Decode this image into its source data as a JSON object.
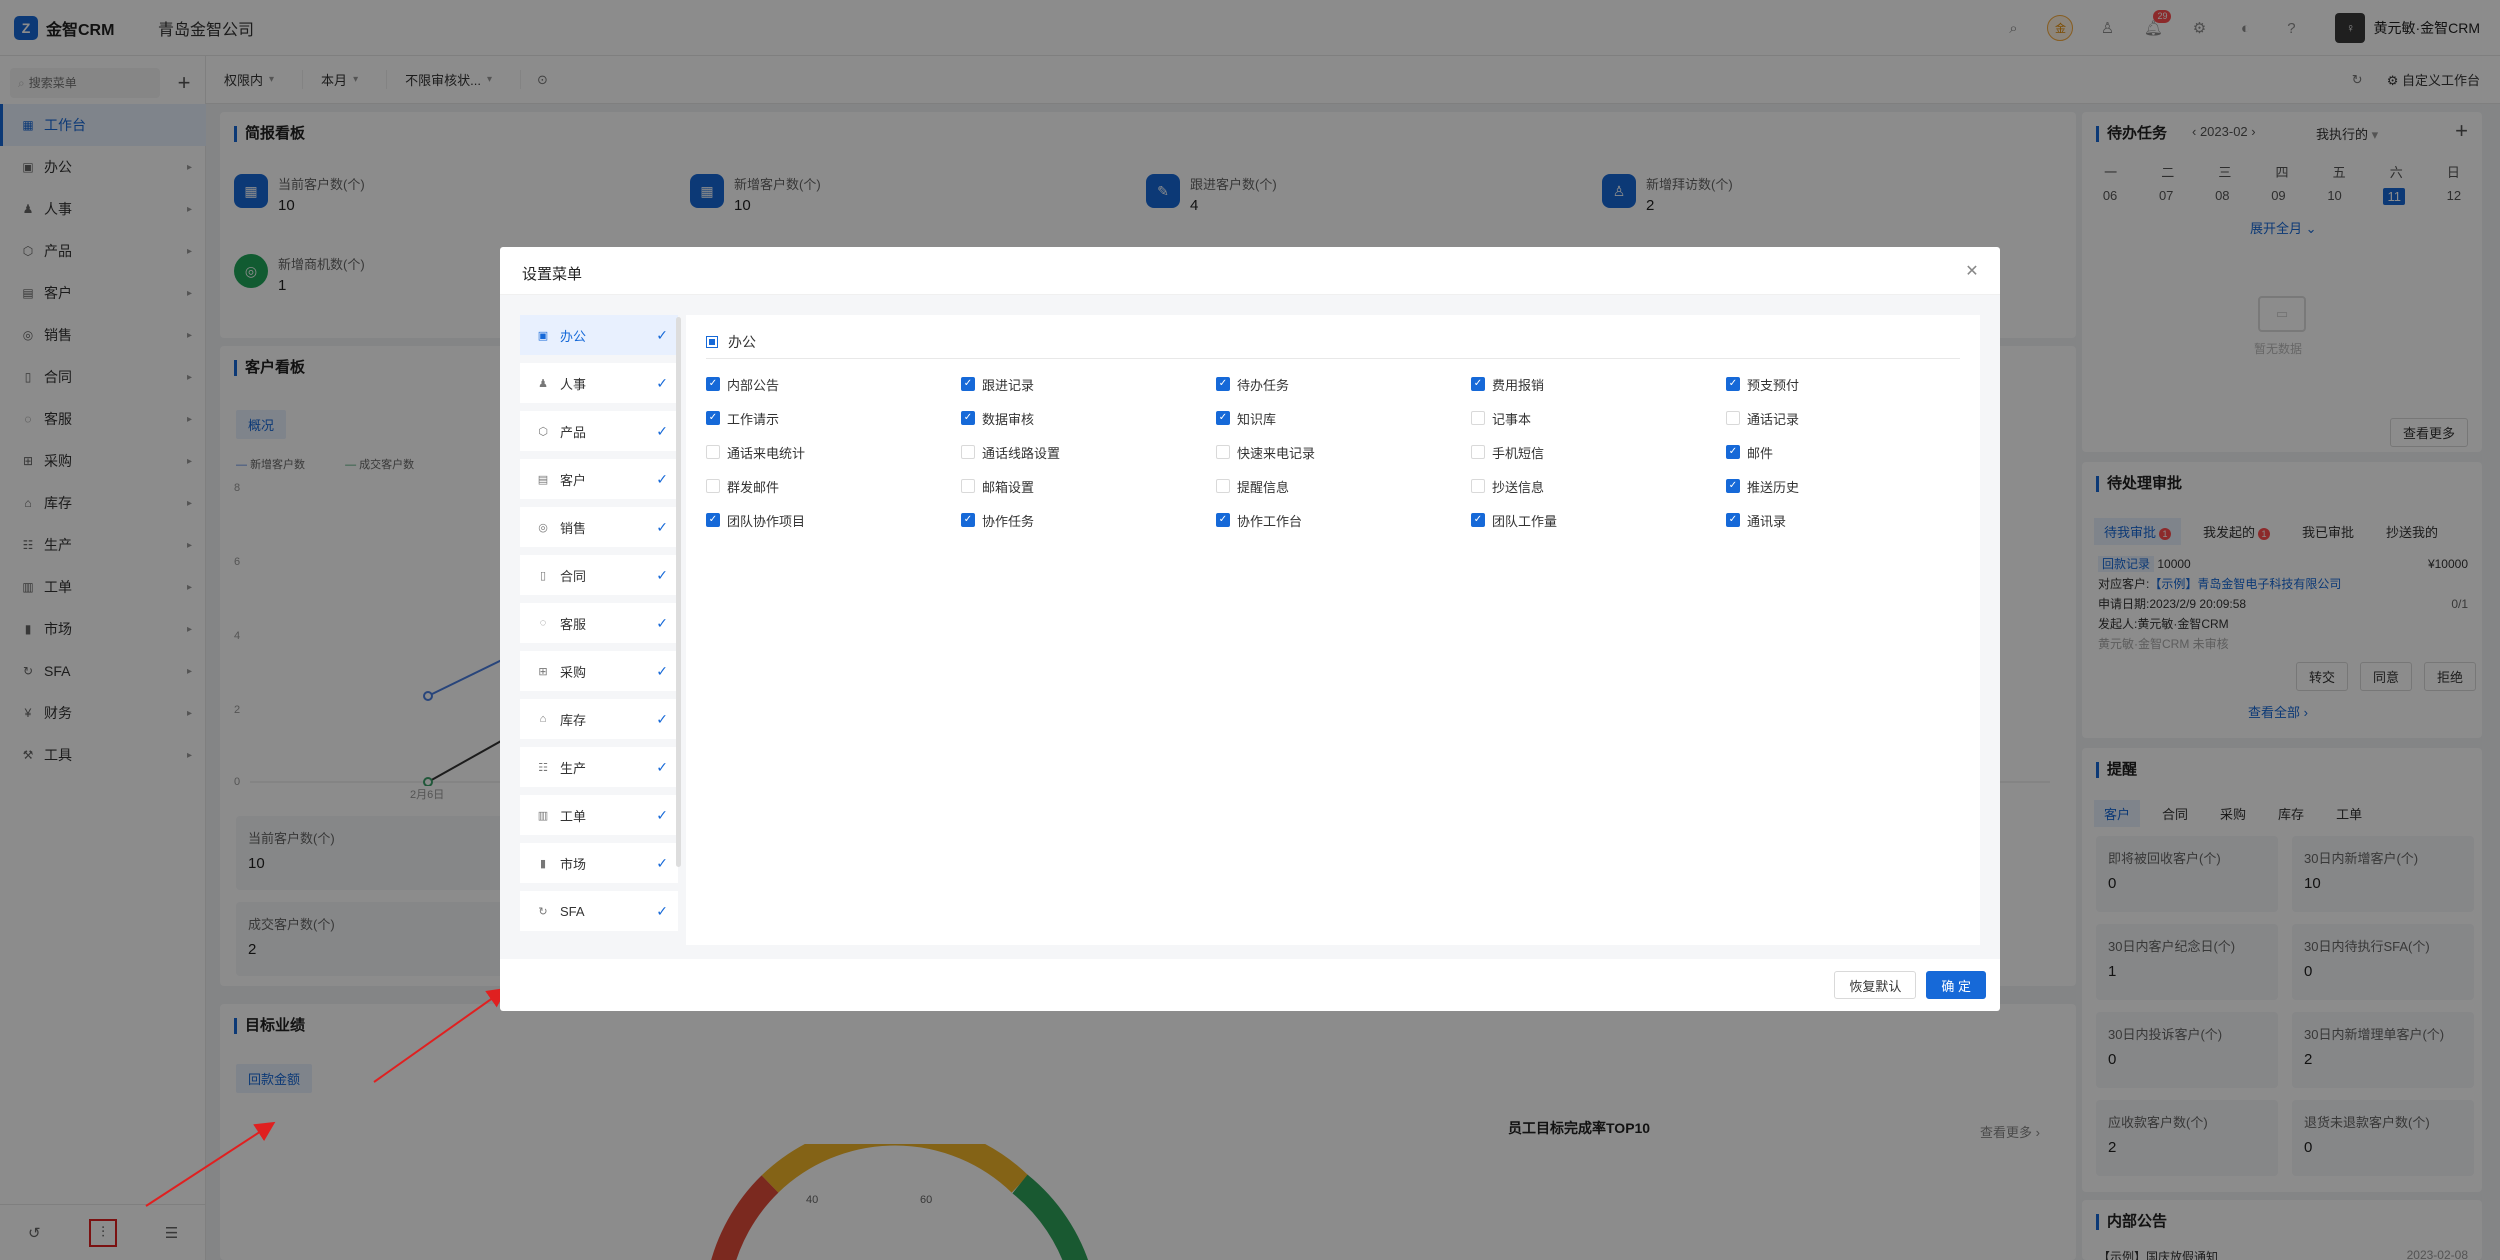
{
  "header": {
    "logo": "金智CRM",
    "company": "青岛金智公司",
    "coin_label": "金",
    "notification_count": "29",
    "user_name": "黄元敏·金智CRM"
  },
  "sidebar": {
    "search_placeholder": "搜索菜单",
    "items": [
      {
        "label": "工作台",
        "icon": "dashboard-icon"
      },
      {
        "label": "办公",
        "icon": "office-icon"
      },
      {
        "label": "人事",
        "icon": "people-icon"
      },
      {
        "label": "产品",
        "icon": "product-icon"
      },
      {
        "label": "客户",
        "icon": "customer-icon"
      },
      {
        "label": "销售",
        "icon": "sales-icon"
      },
      {
        "label": "合同",
        "icon": "contract-icon"
      },
      {
        "label": "客服",
        "icon": "service-icon"
      },
      {
        "label": "采购",
        "icon": "purchase-icon"
      },
      {
        "label": "库存",
        "icon": "inventory-icon"
      },
      {
        "label": "生产",
        "icon": "production-icon"
      },
      {
        "label": "工单",
        "icon": "workorder-icon"
      },
      {
        "label": "市场",
        "icon": "market-icon"
      },
      {
        "label": "SFA",
        "icon": "sfa-icon"
      },
      {
        "label": "财务",
        "icon": "finance-icon"
      },
      {
        "label": "工具",
        "icon": "tools-icon"
      }
    ]
  },
  "toolbar": {
    "filters": [
      "权限内",
      "本月",
      "不限审核状..."
    ],
    "custom_label": "自定义工作台"
  },
  "briefing": {
    "title": "简报看板",
    "stats": [
      {
        "label": "当前客户数(个)",
        "value": "10"
      },
      {
        "label": "新增客户数(个)",
        "value": "10"
      },
      {
        "label": "跟进客户数(个)",
        "value": "4"
      },
      {
        "label": "新增拜访数(个)",
        "value": "2"
      },
      {
        "label": "新增商机数(个)",
        "value": "1"
      }
    ]
  },
  "customer_board": {
    "title": "客户看板",
    "tab": "概况",
    "legend": [
      "新增客户数",
      "成交客户数"
    ],
    "y_ticks": [
      "8",
      "6",
      "4",
      "2",
      "0"
    ],
    "x_tick": "2月6日",
    "boxes": [
      {
        "label": "当前客户数(个)",
        "value": "10"
      },
      {
        "label": "成交客户数(个)",
        "value": "2"
      }
    ]
  },
  "target": {
    "title": "目标业绩",
    "tab": "回款金额",
    "top10_title": "员工目标完成率TOP10",
    "more": "查看更多",
    "gauge_ticks": [
      "40",
      "60"
    ]
  },
  "todo": {
    "title": "待办任务",
    "month": "2023-02",
    "filter": "我执行的",
    "weekdays": [
      "一",
      "二",
      "三",
      "四",
      "五",
      "六",
      "日"
    ],
    "dates": [
      "06",
      "07",
      "08",
      "09",
      "10",
      "11",
      "12"
    ],
    "expand": "展开全月",
    "empty": "暂无数据",
    "more": "查看更多"
  },
  "approval": {
    "title": "待处理审批",
    "tabs": [
      "待我审批",
      "我发起的",
      "我已审批",
      "抄送我的"
    ],
    "tab_badge": "1",
    "item": {
      "type": "回款记录",
      "number": "10000",
      "amount": "¥10000",
      "customer_label": "对应客户:",
      "customer": "【示例】青岛金智电子科技有限公司",
      "date_label": "申请日期:",
      "date": "2023/2/9 20:09:58",
      "progress": "0/1",
      "initiator_label": "发起人:",
      "initiator": "黄元敏·金智CRM",
      "status": "黄元敏·金智CRM 未审核"
    },
    "actions": [
      "转交",
      "同意",
      "拒绝"
    ],
    "view_all": "查看全部"
  },
  "reminder": {
    "title": "提醒",
    "tabs": [
      "客户",
      "合同",
      "采购",
      "库存",
      "工单"
    ],
    "boxes": [
      {
        "label": "即将被回收客户(个)",
        "value": "0"
      },
      {
        "label": "30日内新增客户(个)",
        "value": "10"
      },
      {
        "label": "30日内客户纪念日(个)",
        "value": "1"
      },
      {
        "label": "30日内待执行SFA(个)",
        "value": "0"
      },
      {
        "label": "30日内投诉客户(个)",
        "value": "0"
      },
      {
        "label": "30日内新增理单客户(个)",
        "value": "2"
      },
      {
        "label": "应收款客户数(个)",
        "value": "2"
      },
      {
        "label": "退货未退款客户数(个)",
        "value": "0"
      }
    ]
  },
  "notice": {
    "title": "内部公告",
    "item": "【示例】国庆放假通知",
    "date": "2023-02-08"
  },
  "modal": {
    "title": "设置菜单",
    "categories": [
      {
        "label": "办公",
        "icon": "office-icon"
      },
      {
        "label": "人事",
        "icon": "people-icon"
      },
      {
        "label": "产品",
        "icon": "product-icon"
      },
      {
        "label": "客户",
        "icon": "customer-icon"
      },
      {
        "label": "销售",
        "icon": "sales-icon"
      },
      {
        "label": "合同",
        "icon": "contract-icon"
      },
      {
        "label": "客服",
        "icon": "service-icon"
      },
      {
        "label": "采购",
        "icon": "purchase-icon"
      },
      {
        "label": "库存",
        "icon": "inventory-icon"
      },
      {
        "label": "生产",
        "icon": "production-icon"
      },
      {
        "label": "工单",
        "icon": "workorder-icon"
      },
      {
        "label": "市场",
        "icon": "market-icon"
      },
      {
        "label": "SFA",
        "icon": "sfa-icon"
      }
    ],
    "section": "办公",
    "options": [
      {
        "label": "内部公告",
        "checked": true
      },
      {
        "label": "跟进记录",
        "checked": true
      },
      {
        "label": "待办任务",
        "checked": true
      },
      {
        "label": "费用报销",
        "checked": true
      },
      {
        "label": "预支预付",
        "checked": true
      },
      {
        "label": "工作请示",
        "checked": true
      },
      {
        "label": "数据审核",
        "checked": true
      },
      {
        "label": "知识库",
        "checked": true
      },
      {
        "label": "记事本",
        "checked": false
      },
      {
        "label": "通话记录",
        "checked": false
      },
      {
        "label": "通话来电统计",
        "checked": false
      },
      {
        "label": "通话线路设置",
        "checked": false
      },
      {
        "label": "快速来电记录",
        "checked": false
      },
      {
        "label": "手机短信",
        "checked": false
      },
      {
        "label": "邮件",
        "checked": true
      },
      {
        "label": "群发邮件",
        "checked": false
      },
      {
        "label": "邮箱设置",
        "checked": false
      },
      {
        "label": "提醒信息",
        "checked": false
      },
      {
        "label": "抄送信息",
        "checked": false
      },
      {
        "label": "推送历史",
        "checked": true
      },
      {
        "label": "团队协作项目",
        "checked": true
      },
      {
        "label": "协作任务",
        "checked": true
      },
      {
        "label": "协作工作台",
        "checked": true
      },
      {
        "label": "团队工作量",
        "checked": true
      },
      {
        "label": "通讯录",
        "checked": true
      }
    ],
    "reset_label": "恢复默认",
    "confirm_label": "确 定"
  },
  "colors": {
    "accent": "#1669d8",
    "annotation": "#e02020"
  }
}
